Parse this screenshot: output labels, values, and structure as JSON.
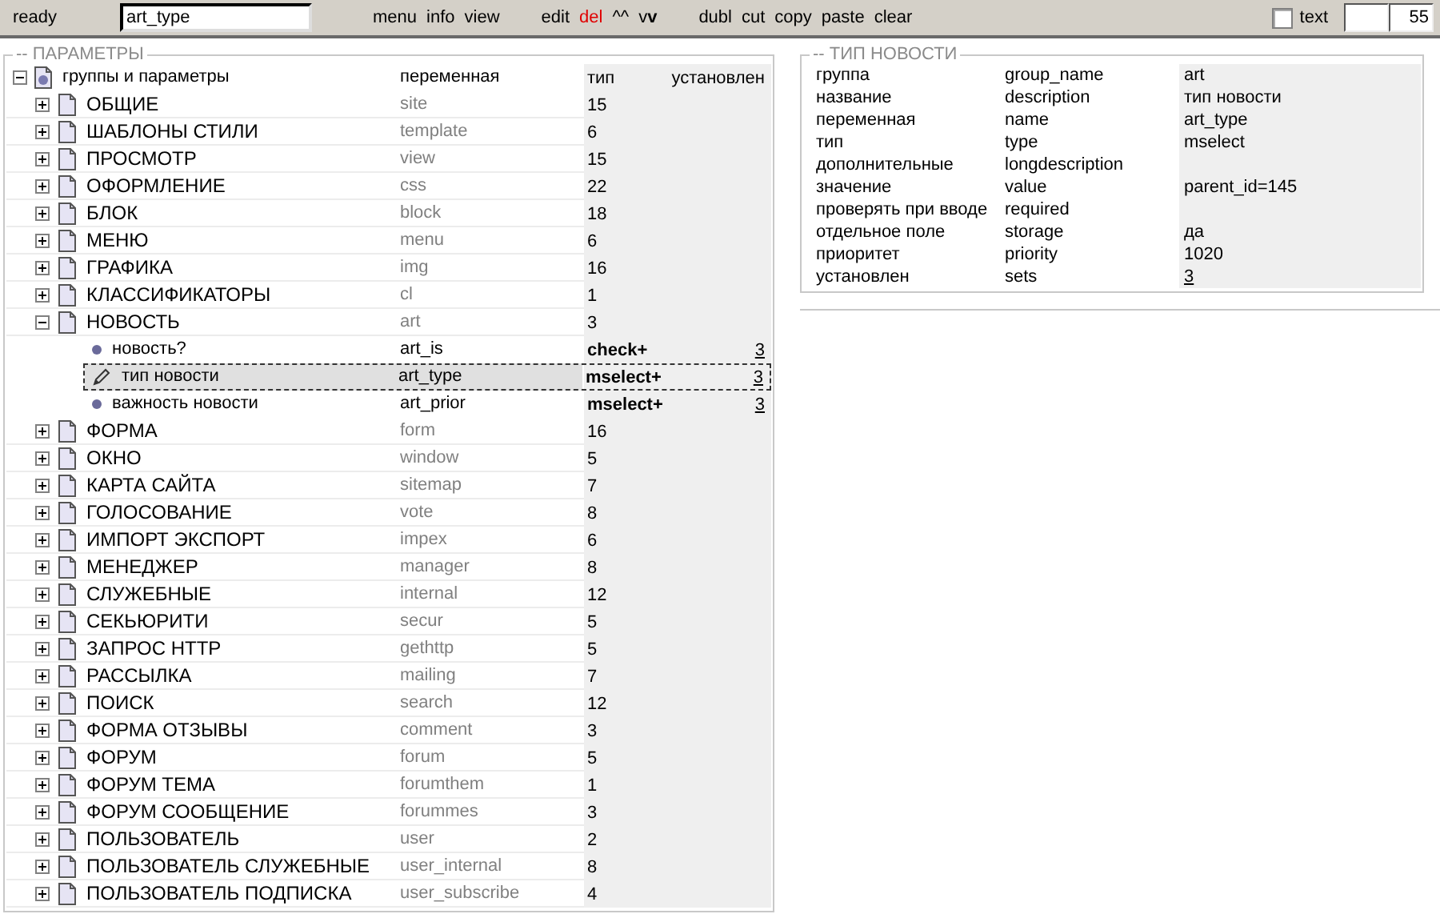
{
  "toolbar": {
    "status": "ready",
    "path_field": {
      "value": "art_type"
    },
    "action_groups": [
      [
        {
          "label": "menu",
          "kind": "normal"
        },
        {
          "label": "info",
          "kind": "normal"
        },
        {
          "label": "view",
          "kind": "normal"
        }
      ],
      [
        {
          "label": "edit",
          "kind": "normal"
        },
        {
          "label": "del",
          "kind": "danger"
        },
        {
          "label": "^^",
          "kind": "normal"
        },
        {
          "label": "v**v**",
          "kind": "normal"
        }
      ],
      [
        {
          "label": "dubl",
          "kind": "normal"
        },
        {
          "label": "cut",
          "kind": "normal"
        },
        {
          "label": "copy",
          "kind": "normal"
        },
        {
          "label": "paste",
          "kind": "normal"
        },
        {
          "label": "clear",
          "kind": "normal"
        }
      ]
    ],
    "text_checkbox": {
      "label": "text",
      "checked": false
    },
    "count_field": {
      "value": "55"
    }
  },
  "parameters": {
    "title": "-- ПАРАМЕТРЫ",
    "tree": {
      "label": "группы и параметры",
      "expanded": true,
      "headers": {
        "variable": "переменная",
        "type": "тип",
        "sets": "установлен"
      },
      "children": [
        {
          "label": "ОБЩИЕ",
          "variable": "site",
          "count": "15",
          "expanded": false
        },
        {
          "label": "ШАБЛОНЫ СТИЛИ",
          "variable": "template",
          "count": "6",
          "expanded": false
        },
        {
          "label": "ПРОСМОТР",
          "variable": "view",
          "count": "15",
          "expanded": false
        },
        {
          "label": "ОФОРМЛЕНИЕ",
          "variable": "css",
          "count": "22",
          "expanded": false
        },
        {
          "label": "БЛОК",
          "variable": "block",
          "count": "18",
          "expanded": false
        },
        {
          "label": "МЕНЮ",
          "variable": "menu",
          "count": "6",
          "expanded": false
        },
        {
          "label": "ГРАФИКА",
          "variable": "img",
          "count": "16",
          "expanded": false
        },
        {
          "label": "КЛАССИФИКАТОРЫ",
          "variable": "cl",
          "count": "1",
          "expanded": false
        },
        {
          "label": "НОВОСТЬ",
          "variable": "art",
          "count": "3",
          "expanded": true,
          "children": [
            {
              "label": "новость?",
              "variable": "art_is",
              "type": "check+",
              "sets": "3",
              "selected": false
            },
            {
              "label": "тип новости",
              "variable": "art_type",
              "type": "mselect+",
              "sets": "3",
              "selected": true
            },
            {
              "label": "важность новости",
              "variable": "art_prior",
              "type": "mselect+",
              "sets": "3",
              "selected": false
            }
          ]
        },
        {
          "label": "ФОРМА",
          "variable": "form",
          "count": "16",
          "expanded": false
        },
        {
          "label": "ОКНО",
          "variable": "window",
          "count": "5",
          "expanded": false
        },
        {
          "label": "КАРТА САЙТА",
          "variable": "sitemap",
          "count": "7",
          "expanded": false
        },
        {
          "label": "ГОЛОСОВАНИЕ",
          "variable": "vote",
          "count": "8",
          "expanded": false
        },
        {
          "label": "ИМПОРТ ЭКСПОРТ",
          "variable": "impex",
          "count": "6",
          "expanded": false
        },
        {
          "label": "МЕНЕДЖЕР",
          "variable": "manager",
          "count": "8",
          "expanded": false
        },
        {
          "label": "СЛУЖЕБНЫЕ",
          "variable": "internal",
          "count": "12",
          "expanded": false
        },
        {
          "label": "СЕКЬЮРИТИ",
          "variable": "secur",
          "count": "5",
          "expanded": false
        },
        {
          "label": "ЗАПРОС HTTP",
          "variable": "gethttp",
          "count": "5",
          "expanded": false
        },
        {
          "label": "РАССЫЛКА",
          "variable": "mailing",
          "count": "7",
          "expanded": false
        },
        {
          "label": "ПОИСК",
          "variable": "search",
          "count": "12",
          "expanded": false
        },
        {
          "label": "ФОРМА ОТЗЫВЫ",
          "variable": "comment",
          "count": "3",
          "expanded": false
        },
        {
          "label": "ФОРУМ",
          "variable": "forum",
          "count": "5",
          "expanded": false
        },
        {
          "label": "ФОРУМ ТЕМА",
          "variable": "forumthem",
          "count": "1",
          "expanded": false
        },
        {
          "label": "ФОРУМ СООБЩЕНИЕ",
          "variable": "forummes",
          "count": "3",
          "expanded": false
        },
        {
          "label": "ПОЛЬЗОВАТЕЛЬ",
          "variable": "user",
          "count": "2",
          "expanded": false
        },
        {
          "label": "ПОЛЬЗОВАТЕЛЬ СЛУЖЕБНЫЕ",
          "variable": "user_internal",
          "count": "8",
          "expanded": false
        },
        {
          "label": "ПОЛЬЗОВАТЕЛЬ ПОДПИСКА",
          "variable": "user_subscribe",
          "count": "4",
          "expanded": false
        }
      ]
    }
  },
  "details": {
    "title": "-- ТИП НОВОСТИ",
    "rows": [
      {
        "label": "группа",
        "field": "group_name",
        "value": "art",
        "kind": "text"
      },
      {
        "label": "название",
        "field": "description",
        "value": "тип новости",
        "kind": "text"
      },
      {
        "label": "переменная",
        "field": "name",
        "value": "art_type",
        "kind": "text"
      },
      {
        "label": "тип",
        "field": "type",
        "value": "mselect",
        "kind": "text"
      },
      {
        "label": "дополнительные",
        "field": "longdescription"
      },
      {
        "label": "значение",
        "field": "value",
        "value": "parent_id=145",
        "kind": "text"
      },
      {
        "label": "проверять при вводе",
        "field": "required"
      },
      {
        "label": "отдельное поле",
        "field": "storage",
        "value": "да",
        "kind": "text"
      },
      {
        "label": "приоритет",
        "field": "priority",
        "value": "1020",
        "kind": "text"
      },
      {
        "label": "установлен",
        "field": "sets",
        "value": "3",
        "kind": "link"
      }
    ]
  }
}
